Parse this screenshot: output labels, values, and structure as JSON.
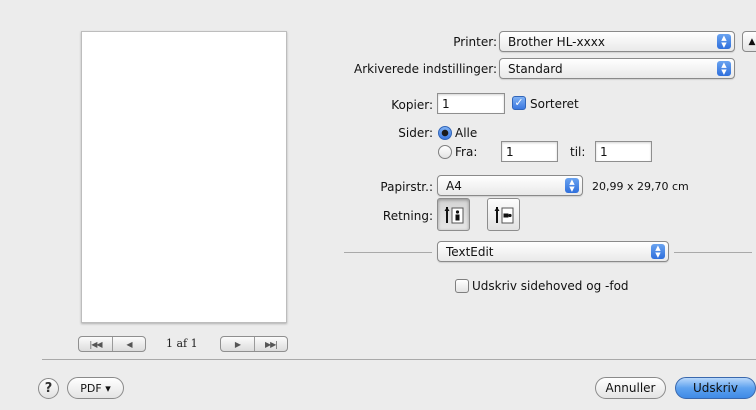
{
  "preview": {
    "page_label": "1 af 1",
    "first_icon": "first-page-icon",
    "prev_icon": "previous-page-icon",
    "next_icon": "next-page-icon",
    "last_icon": "last-page-icon"
  },
  "printer": {
    "label": "Printer:",
    "value": "Brother HL-xxxx"
  },
  "presets": {
    "label": "Arkiverede indstillinger:",
    "value": "Standard"
  },
  "copies": {
    "label": "Kopier:",
    "value": "1",
    "collated_label": "Sorteret",
    "collated": true
  },
  "pages": {
    "label": "Sider:",
    "all_label": "Alle",
    "from_label": "Fra:",
    "from_value": "1",
    "to_label": "til:",
    "to_value": "1",
    "selected": "all"
  },
  "paper": {
    "label": "Papirstr.:",
    "value": "A4",
    "size_text": "20,99 x 29,70 cm"
  },
  "orientation": {
    "label": "Retning:",
    "selected": "portrait"
  },
  "section": {
    "value": "TextEdit"
  },
  "header_footer": {
    "label": "Udskriv sidehoved og -fod",
    "checked": false
  },
  "bottom": {
    "help_label": "?",
    "pdf_label": "PDF ▾",
    "cancel_label": "Annuller",
    "print_label": "Udskriv"
  },
  "colors": {
    "accent": "#3f8ae6",
    "window_bg": "#ececec"
  }
}
